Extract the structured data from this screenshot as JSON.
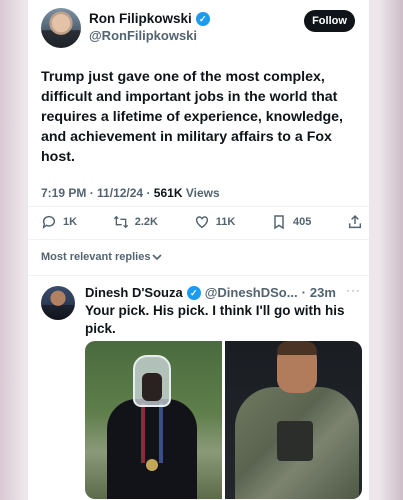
{
  "tweet": {
    "author_name": "Ron Filipkowski",
    "author_handle": "@RonFilipkowski",
    "follow_label": "Follow",
    "text": "Trump just gave one of the most complex, difficult and important jobs in the world that requires a lifetime of experience, knowledge, and achievement in military affairs to a Fox host.",
    "time": "7:19 PM",
    "date": "11/12/24",
    "views_count": "561K",
    "views_label": "Views",
    "replies": "1K",
    "reposts": "2.2K",
    "likes": "11K",
    "bookmarks": "405"
  },
  "sort_label": "Most relevant replies",
  "reply": {
    "author_name": "Dinesh D'Souza",
    "author_handle": "@DineshDSo...",
    "time": "23m",
    "more": "···",
    "text": "Your pick. His pick. I think I'll go with his pick."
  },
  "colors": {
    "verified": "#1d9bf0",
    "follow_bg": "#0f1419",
    "secondary_text": "#536471"
  }
}
